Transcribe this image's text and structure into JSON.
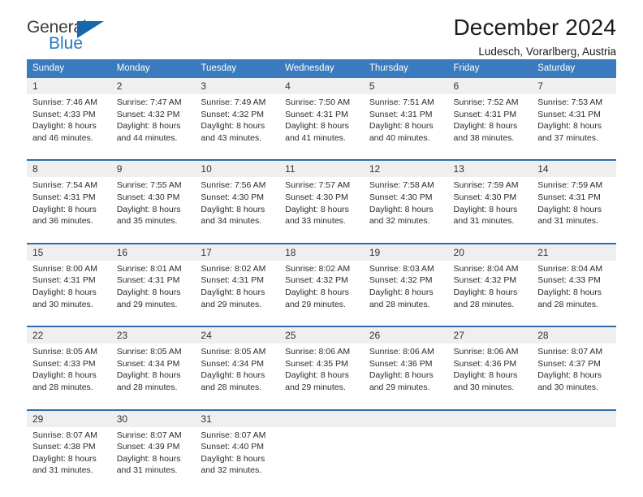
{
  "brand": {
    "name_top": "General",
    "name_bottom": "Blue",
    "triangle_color": "#1667ae",
    "blue_text_color": "#2a7ac0"
  },
  "header": {
    "title": "December 2024",
    "subtitle": "Ludesch, Vorarlberg, Austria"
  },
  "theme": {
    "header_blue": "#3a7bbd",
    "rule_blue": "#2f6daa",
    "daynum_band": "#efefef"
  },
  "calendar": {
    "weekday_headers": [
      "Sunday",
      "Monday",
      "Tuesday",
      "Wednesday",
      "Thursday",
      "Friday",
      "Saturday"
    ],
    "weeks": [
      {
        "days": [
          {
            "number": "1",
            "sunrise": "Sunrise: 7:46 AM",
            "sunset": "Sunset: 4:33 PM",
            "daylight_line1": "Daylight: 8 hours",
            "daylight_line2": "and 46 minutes."
          },
          {
            "number": "2",
            "sunrise": "Sunrise: 7:47 AM",
            "sunset": "Sunset: 4:32 PM",
            "daylight_line1": "Daylight: 8 hours",
            "daylight_line2": "and 44 minutes."
          },
          {
            "number": "3",
            "sunrise": "Sunrise: 7:49 AM",
            "sunset": "Sunset: 4:32 PM",
            "daylight_line1": "Daylight: 8 hours",
            "daylight_line2": "and 43 minutes."
          },
          {
            "number": "4",
            "sunrise": "Sunrise: 7:50 AM",
            "sunset": "Sunset: 4:31 PM",
            "daylight_line1": "Daylight: 8 hours",
            "daylight_line2": "and 41 minutes."
          },
          {
            "number": "5",
            "sunrise": "Sunrise: 7:51 AM",
            "sunset": "Sunset: 4:31 PM",
            "daylight_line1": "Daylight: 8 hours",
            "daylight_line2": "and 40 minutes."
          },
          {
            "number": "6",
            "sunrise": "Sunrise: 7:52 AM",
            "sunset": "Sunset: 4:31 PM",
            "daylight_line1": "Daylight: 8 hours",
            "daylight_line2": "and 38 minutes."
          },
          {
            "number": "7",
            "sunrise": "Sunrise: 7:53 AM",
            "sunset": "Sunset: 4:31 PM",
            "daylight_line1": "Daylight: 8 hours",
            "daylight_line2": "and 37 minutes."
          }
        ]
      },
      {
        "days": [
          {
            "number": "8",
            "sunrise": "Sunrise: 7:54 AM",
            "sunset": "Sunset: 4:31 PM",
            "daylight_line1": "Daylight: 8 hours",
            "daylight_line2": "and 36 minutes."
          },
          {
            "number": "9",
            "sunrise": "Sunrise: 7:55 AM",
            "sunset": "Sunset: 4:30 PM",
            "daylight_line1": "Daylight: 8 hours",
            "daylight_line2": "and 35 minutes."
          },
          {
            "number": "10",
            "sunrise": "Sunrise: 7:56 AM",
            "sunset": "Sunset: 4:30 PM",
            "daylight_line1": "Daylight: 8 hours",
            "daylight_line2": "and 34 minutes."
          },
          {
            "number": "11",
            "sunrise": "Sunrise: 7:57 AM",
            "sunset": "Sunset: 4:30 PM",
            "daylight_line1": "Daylight: 8 hours",
            "daylight_line2": "and 33 minutes."
          },
          {
            "number": "12",
            "sunrise": "Sunrise: 7:58 AM",
            "sunset": "Sunset: 4:30 PM",
            "daylight_line1": "Daylight: 8 hours",
            "daylight_line2": "and 32 minutes."
          },
          {
            "number": "13",
            "sunrise": "Sunrise: 7:59 AM",
            "sunset": "Sunset: 4:30 PM",
            "daylight_line1": "Daylight: 8 hours",
            "daylight_line2": "and 31 minutes."
          },
          {
            "number": "14",
            "sunrise": "Sunrise: 7:59 AM",
            "sunset": "Sunset: 4:31 PM",
            "daylight_line1": "Daylight: 8 hours",
            "daylight_line2": "and 31 minutes."
          }
        ]
      },
      {
        "days": [
          {
            "number": "15",
            "sunrise": "Sunrise: 8:00 AM",
            "sunset": "Sunset: 4:31 PM",
            "daylight_line1": "Daylight: 8 hours",
            "daylight_line2": "and 30 minutes."
          },
          {
            "number": "16",
            "sunrise": "Sunrise: 8:01 AM",
            "sunset": "Sunset: 4:31 PM",
            "daylight_line1": "Daylight: 8 hours",
            "daylight_line2": "and 29 minutes."
          },
          {
            "number": "17",
            "sunrise": "Sunrise: 8:02 AM",
            "sunset": "Sunset: 4:31 PM",
            "daylight_line1": "Daylight: 8 hours",
            "daylight_line2": "and 29 minutes."
          },
          {
            "number": "18",
            "sunrise": "Sunrise: 8:02 AM",
            "sunset": "Sunset: 4:32 PM",
            "daylight_line1": "Daylight: 8 hours",
            "daylight_line2": "and 29 minutes."
          },
          {
            "number": "19",
            "sunrise": "Sunrise: 8:03 AM",
            "sunset": "Sunset: 4:32 PM",
            "daylight_line1": "Daylight: 8 hours",
            "daylight_line2": "and 28 minutes."
          },
          {
            "number": "20",
            "sunrise": "Sunrise: 8:04 AM",
            "sunset": "Sunset: 4:32 PM",
            "daylight_line1": "Daylight: 8 hours",
            "daylight_line2": "and 28 minutes."
          },
          {
            "number": "21",
            "sunrise": "Sunrise: 8:04 AM",
            "sunset": "Sunset: 4:33 PM",
            "daylight_line1": "Daylight: 8 hours",
            "daylight_line2": "and 28 minutes."
          }
        ]
      },
      {
        "days": [
          {
            "number": "22",
            "sunrise": "Sunrise: 8:05 AM",
            "sunset": "Sunset: 4:33 PM",
            "daylight_line1": "Daylight: 8 hours",
            "daylight_line2": "and 28 minutes."
          },
          {
            "number": "23",
            "sunrise": "Sunrise: 8:05 AM",
            "sunset": "Sunset: 4:34 PM",
            "daylight_line1": "Daylight: 8 hours",
            "daylight_line2": "and 28 minutes."
          },
          {
            "number": "24",
            "sunrise": "Sunrise: 8:05 AM",
            "sunset": "Sunset: 4:34 PM",
            "daylight_line1": "Daylight: 8 hours",
            "daylight_line2": "and 28 minutes."
          },
          {
            "number": "25",
            "sunrise": "Sunrise: 8:06 AM",
            "sunset": "Sunset: 4:35 PM",
            "daylight_line1": "Daylight: 8 hours",
            "daylight_line2": "and 29 minutes."
          },
          {
            "number": "26",
            "sunrise": "Sunrise: 8:06 AM",
            "sunset": "Sunset: 4:36 PM",
            "daylight_line1": "Daylight: 8 hours",
            "daylight_line2": "and 29 minutes."
          },
          {
            "number": "27",
            "sunrise": "Sunrise: 8:06 AM",
            "sunset": "Sunset: 4:36 PM",
            "daylight_line1": "Daylight: 8 hours",
            "daylight_line2": "and 30 minutes."
          },
          {
            "number": "28",
            "sunrise": "Sunrise: 8:07 AM",
            "sunset": "Sunset: 4:37 PM",
            "daylight_line1": "Daylight: 8 hours",
            "daylight_line2": "and 30 minutes."
          }
        ]
      },
      {
        "days": [
          {
            "number": "29",
            "sunrise": "Sunrise: 8:07 AM",
            "sunset": "Sunset: 4:38 PM",
            "daylight_line1": "Daylight: 8 hours",
            "daylight_line2": "and 31 minutes."
          },
          {
            "number": "30",
            "sunrise": "Sunrise: 8:07 AM",
            "sunset": "Sunset: 4:39 PM",
            "daylight_line1": "Daylight: 8 hours",
            "daylight_line2": "and 31 minutes."
          },
          {
            "number": "31",
            "sunrise": "Sunrise: 8:07 AM",
            "sunset": "Sunset: 4:40 PM",
            "daylight_line1": "Daylight: 8 hours",
            "daylight_line2": "and 32 minutes."
          },
          {
            "number": "",
            "sunrise": "",
            "sunset": "",
            "daylight_line1": "",
            "daylight_line2": ""
          },
          {
            "number": "",
            "sunrise": "",
            "sunset": "",
            "daylight_line1": "",
            "daylight_line2": ""
          },
          {
            "number": "",
            "sunrise": "",
            "sunset": "",
            "daylight_line1": "",
            "daylight_line2": ""
          },
          {
            "number": "",
            "sunrise": "",
            "sunset": "",
            "daylight_line1": "",
            "daylight_line2": ""
          }
        ]
      }
    ]
  }
}
